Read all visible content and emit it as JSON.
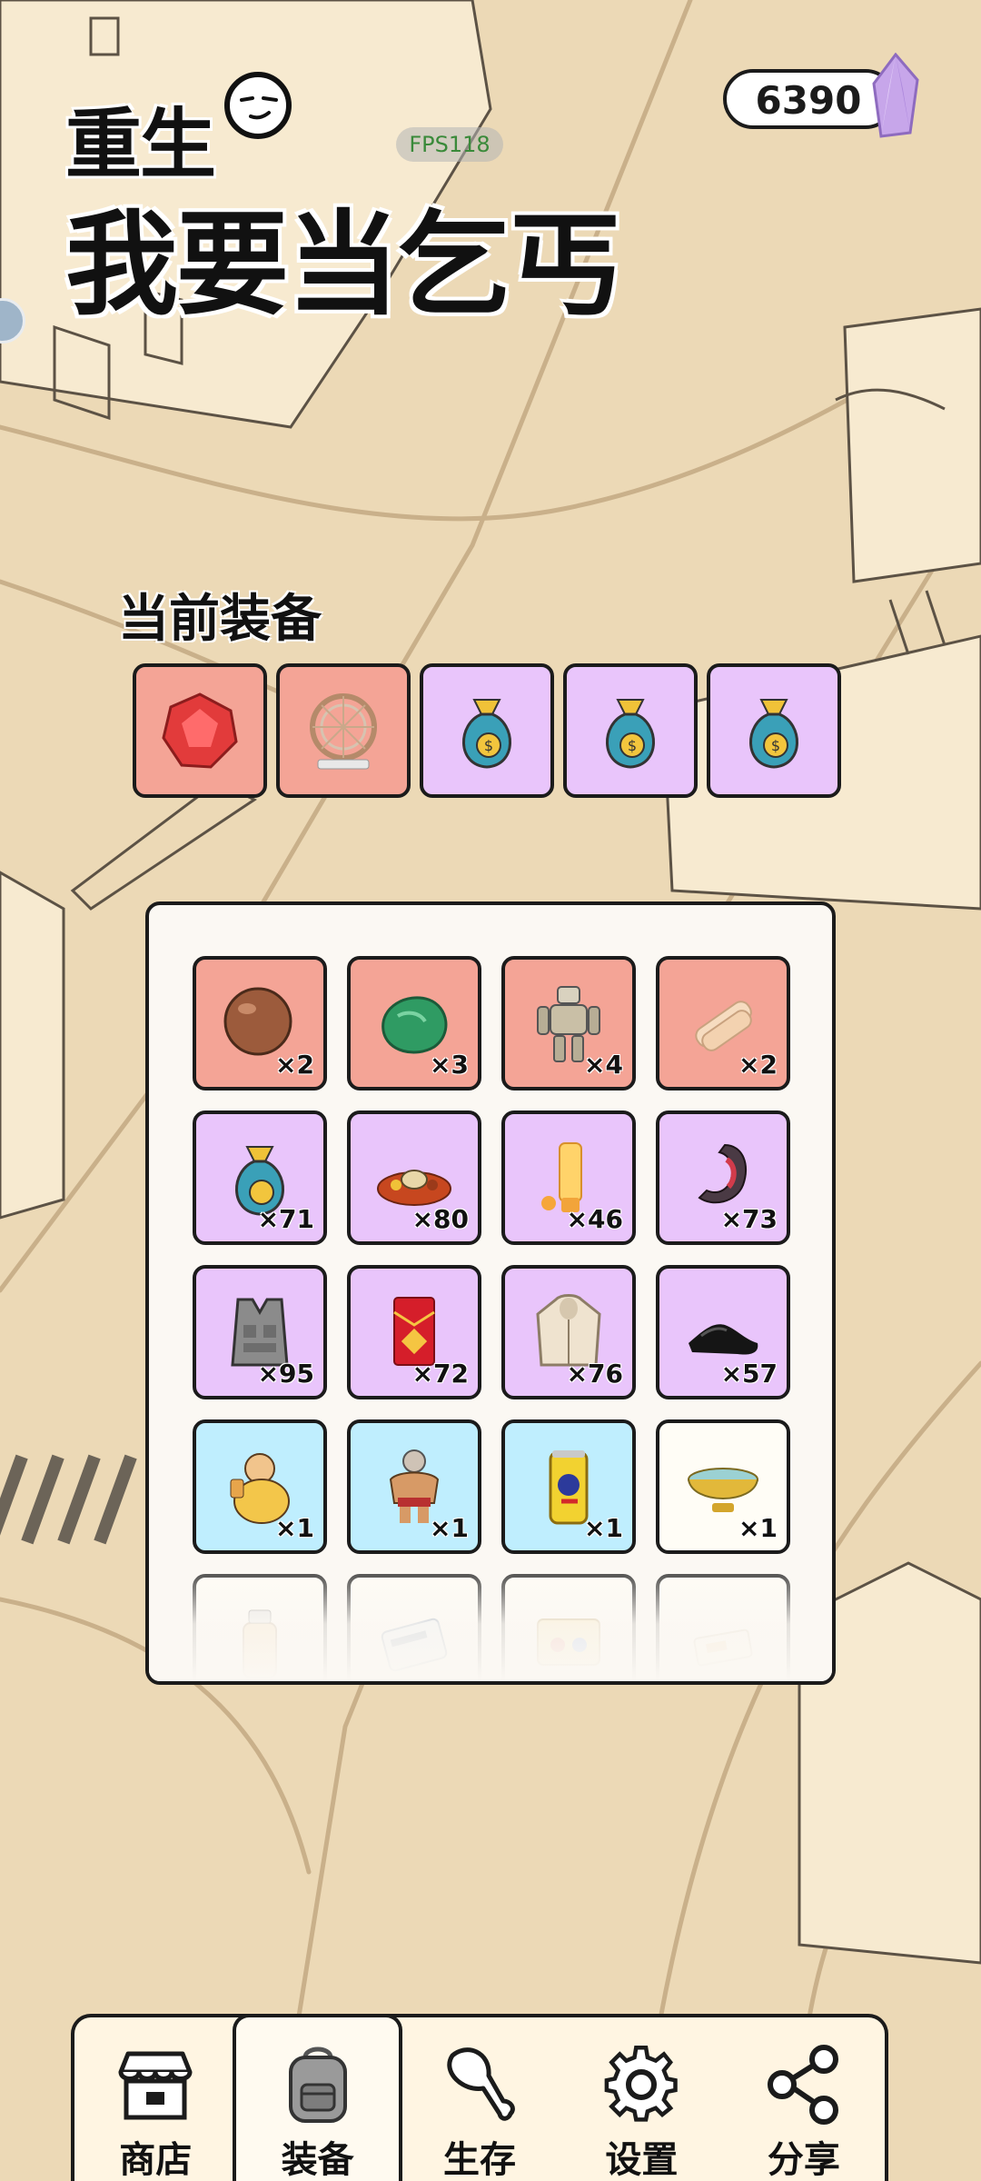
{
  "title": {
    "line1": "重生",
    "line2": "我要当乞丐"
  },
  "fps": "FPS118",
  "currency": {
    "value": "6390",
    "icon": "gem-icon"
  },
  "equipped": {
    "label": "当前装备",
    "slots": [
      {
        "item": "ruby-gem",
        "rarity": "red"
      },
      {
        "item": "hamster-wheel",
        "rarity": "red"
      },
      {
        "item": "money-bag",
        "rarity": "purple"
      },
      {
        "item": "money-bag",
        "rarity": "purple"
      },
      {
        "item": "money-bag",
        "rarity": "purple"
      }
    ]
  },
  "inventory": {
    "items": [
      {
        "icon": "ball-icon",
        "rarity": "red",
        "count": "×2"
      },
      {
        "icon": "jade-rock-icon",
        "rarity": "red",
        "count": "×3"
      },
      {
        "icon": "robot-icon",
        "rarity": "red",
        "count": "×4"
      },
      {
        "icon": "bandage-icon",
        "rarity": "red",
        "count": "×2"
      },
      {
        "icon": "money-bag-icon",
        "rarity": "purple",
        "count": "×71"
      },
      {
        "icon": "food-platter-icon",
        "rarity": "purple",
        "count": "×80"
      },
      {
        "icon": "sunscreen-icon",
        "rarity": "purple",
        "count": "×46"
      },
      {
        "icon": "stomach-icon",
        "rarity": "purple",
        "count": "×73"
      },
      {
        "icon": "vest-icon",
        "rarity": "purple",
        "count": "×95"
      },
      {
        "icon": "red-envelope-icon",
        "rarity": "purple",
        "count": "×72"
      },
      {
        "icon": "hoodie-icon",
        "rarity": "purple",
        "count": "×76"
      },
      {
        "icon": "shoes-icon",
        "rarity": "purple",
        "count": "×57"
      },
      {
        "icon": "fat-man-icon",
        "rarity": "blue",
        "count": "×1"
      },
      {
        "icon": "wrestler-icon",
        "rarity": "blue",
        "count": "×1"
      },
      {
        "icon": "energy-drink-icon",
        "rarity": "blue",
        "count": "×1"
      },
      {
        "icon": "bowl-icon",
        "rarity": "white",
        "count": "×1"
      },
      {
        "icon": "jar-icon",
        "rarity": "white",
        "count": ""
      },
      {
        "icon": "card-icon",
        "rarity": "white",
        "count": ""
      },
      {
        "icon": "ticket-icon",
        "rarity": "white",
        "count": ""
      },
      {
        "icon": "paper-icon",
        "rarity": "white",
        "count": ""
      }
    ]
  },
  "nav": {
    "items": [
      {
        "label": "商店",
        "icon": "shop-icon"
      },
      {
        "label": "装备",
        "icon": "backpack-icon",
        "active": true
      },
      {
        "label": "生存",
        "icon": "drumstick-icon"
      },
      {
        "label": "设置",
        "icon": "gear-icon"
      },
      {
        "label": "分享",
        "icon": "share-icon"
      }
    ]
  }
}
